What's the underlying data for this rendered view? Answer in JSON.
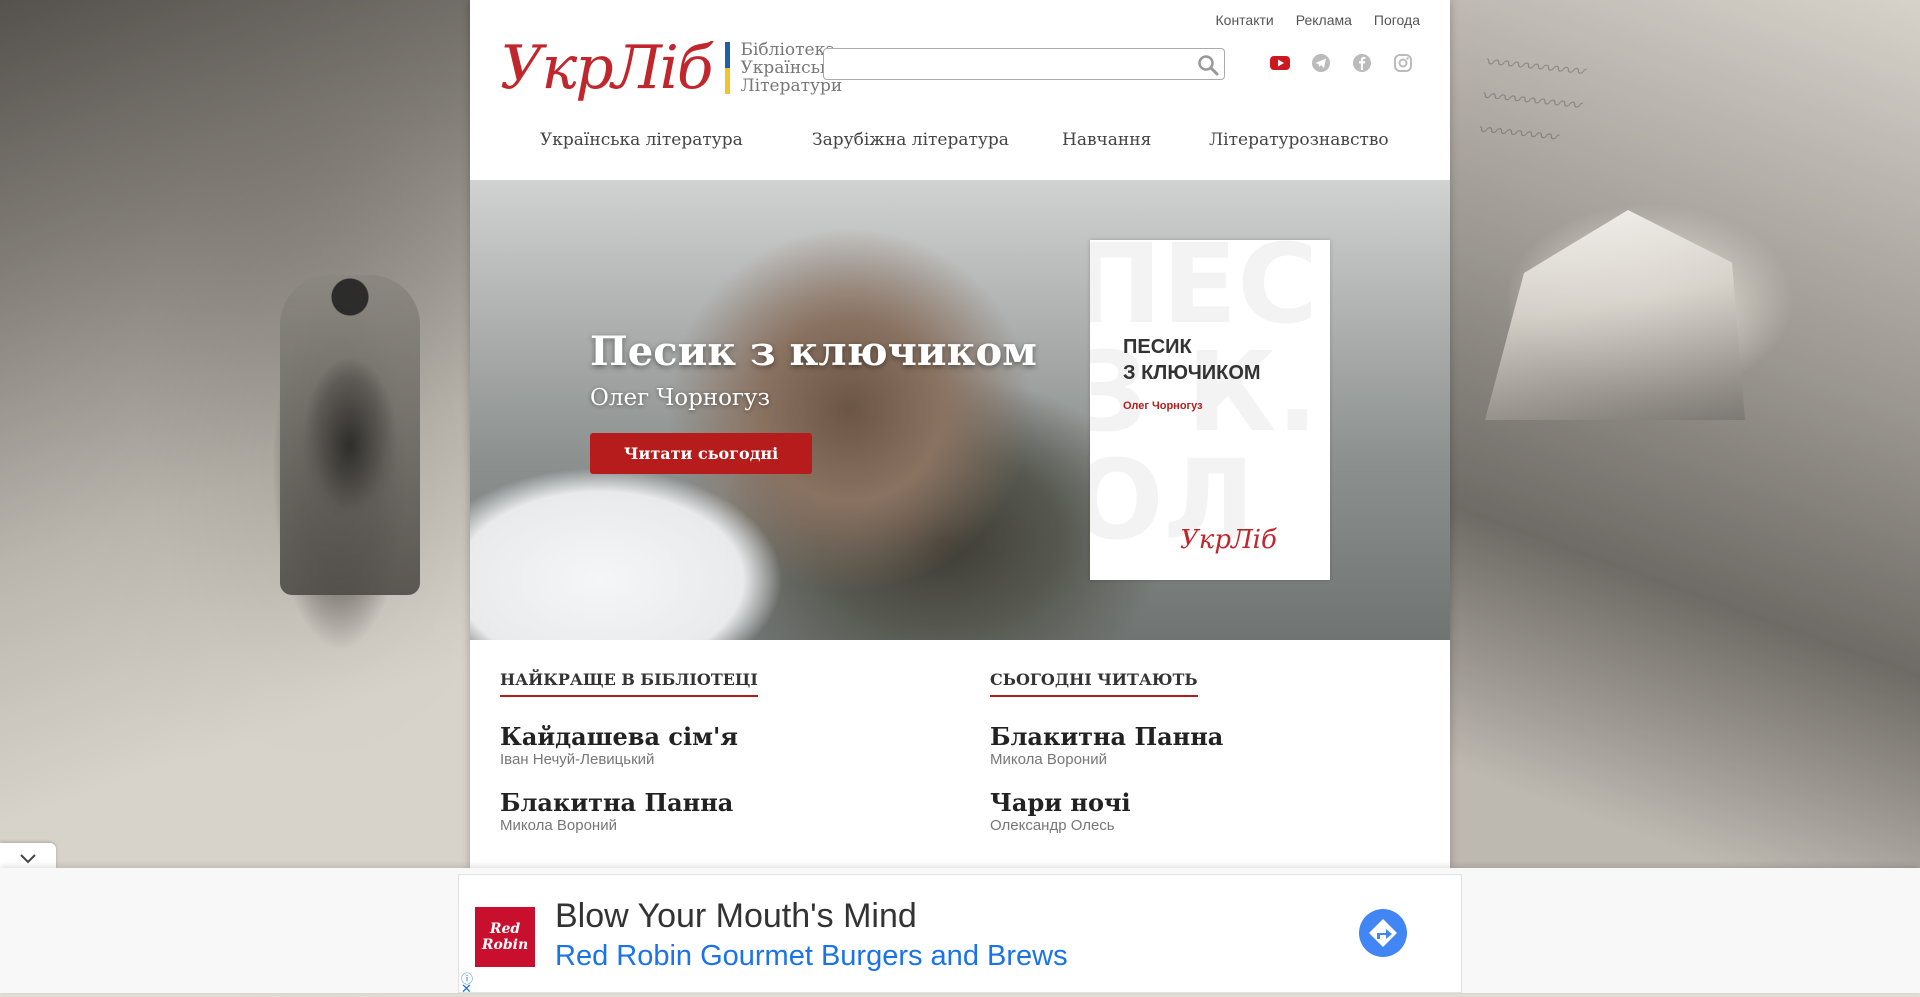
{
  "top_links": [
    "Контакти",
    "Реклама",
    "Погода"
  ],
  "logo": {
    "mark": "УкрЛіб",
    "line1": "Бібліотека",
    "line2": "Української",
    "line3": "Літератури"
  },
  "search": {
    "value": "",
    "placeholder": ""
  },
  "socials": [
    "youtube-icon",
    "telegram-icon",
    "facebook-icon",
    "instagram-icon"
  ],
  "nav": [
    "Українська література",
    "Зарубіжна література",
    "Навчання",
    "Літературознавство"
  ],
  "hero": {
    "title": "Песик з ключиком",
    "author": "Олег Чорногуз",
    "button": "Читати сьогодні",
    "cover_title": "ПЕСИК\nЗ КЛЮЧИКОМ",
    "cover_author": "Олег Чорногуз",
    "cover_logo": "УкрЛіб"
  },
  "best": {
    "heading": "НАЙКРАЩЕ В БІБЛІОТЕЦІ",
    "items": [
      {
        "title": "Кайдашева сім'я",
        "author": "Іван Нечуй-Левицький"
      },
      {
        "title": "Блакитна Панна",
        "author": "Микола Вороний"
      }
    ]
  },
  "today": {
    "heading": "СЬОГОДНІ ЧИТАЮТЬ",
    "items": [
      {
        "title": "Блакитна Панна",
        "author": "Микола Вороний"
      },
      {
        "title": "Чари ночі",
        "author": "Олександр Олесь"
      }
    ]
  },
  "ad": {
    "logo": "Red\nRobin",
    "headline": "Blow Your Mouth's Mind",
    "subline": "Red Robin Gourmet Burgers and Brews",
    "info": "ⓘ",
    "close": "✕"
  },
  "colors": {
    "accent": "#b71c1c",
    "ad_link": "#1a73e8"
  }
}
